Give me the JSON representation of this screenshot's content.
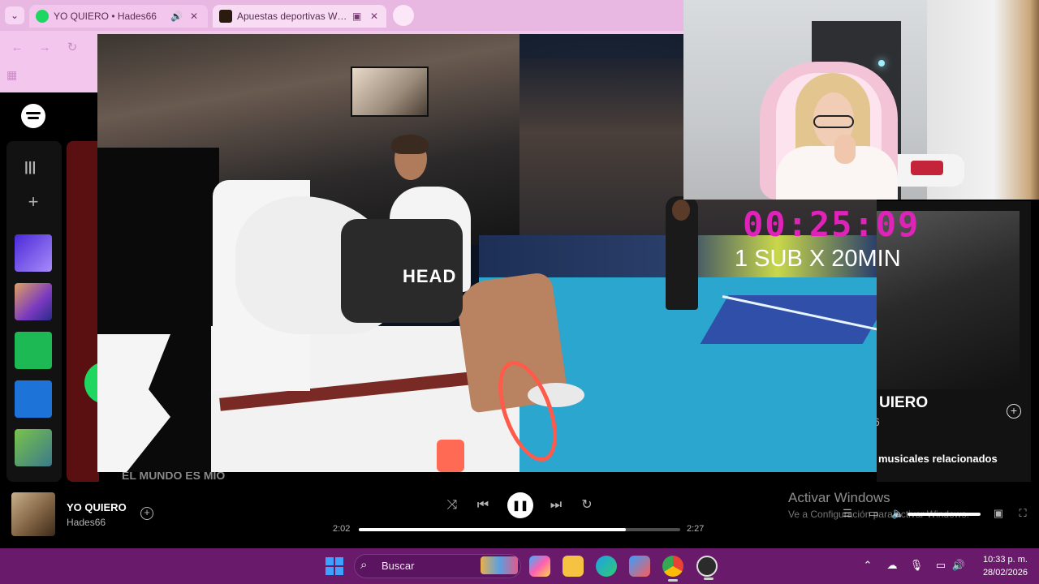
{
  "browser": {
    "tabs": [
      {
        "title": "YO QUIERO • Hades66",
        "active": true
      },
      {
        "title": "Apuestas deportivas Wplay",
        "active": false
      }
    ]
  },
  "spotify": {
    "right_panel": {
      "title": "UIERO",
      "subtitle": "6",
      "related_heading": "musicales relacionados"
    },
    "ghost_track": "EL MUNDO ES MIO",
    "now_playing": {
      "title": "YO QUIERO",
      "artist": "Hades66"
    },
    "player": {
      "elapsed": "2:02",
      "duration": "2:27",
      "progress": 0.83
    }
  },
  "video": {
    "bag_brand": "HEAD"
  },
  "overlay": {
    "timer": "00:25:09",
    "subtitle": "1 SUB X 20MIN"
  },
  "watermark": {
    "line1": "Activar Windows",
    "line2": "Ve a Configuración para activar Windows."
  },
  "taskbar": {
    "search_label": "Buscar",
    "time": "10:33 p. m.",
    "date": "28/02/2026"
  },
  "colors": {
    "spotify_green": "#1ed760",
    "timer_magenta": "#e023b8",
    "taskbar": "#6a1a6a"
  }
}
